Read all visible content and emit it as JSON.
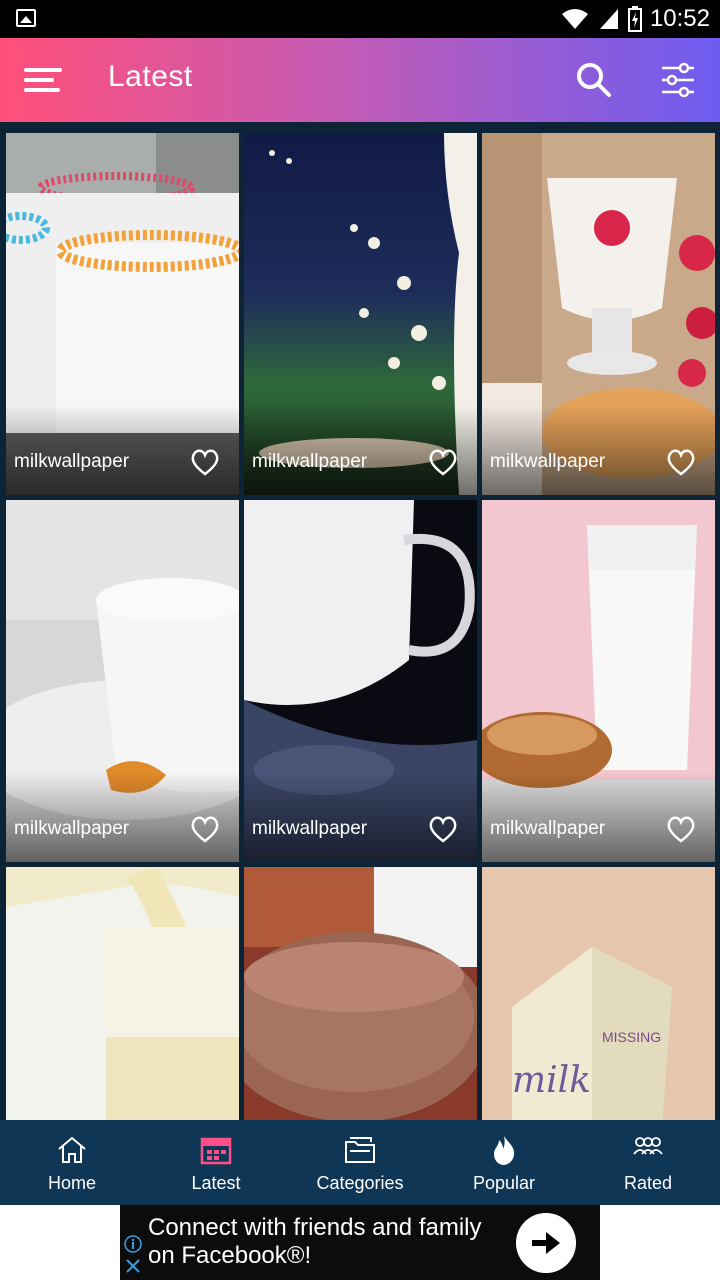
{
  "status_bar": {
    "time": "10:52"
  },
  "app_bar": {
    "title": "Latest"
  },
  "grid": {
    "items": [
      {
        "label": "milkwallpaper"
      },
      {
        "label": "milkwallpaper"
      },
      {
        "label": "milkwallpaper"
      },
      {
        "label": "milkwallpaper"
      },
      {
        "label": "milkwallpaper"
      },
      {
        "label": "milkwallpaper"
      },
      {
        "label": ""
      },
      {
        "label": ""
      },
      {
        "label": ""
      }
    ],
    "carton_text": {
      "missing": "MISSING",
      "milk": "milk"
    }
  },
  "bottom_nav": {
    "items": [
      {
        "label": "Home",
        "icon": "home-icon"
      },
      {
        "label": "Latest",
        "icon": "calendar-icon",
        "active": true
      },
      {
        "label": "Categories",
        "icon": "folder-icon"
      },
      {
        "label": "Popular",
        "icon": "fire-icon"
      },
      {
        "label": "Rated",
        "icon": "group-icon"
      }
    ],
    "active_color": "#ff4f8a"
  },
  "ad": {
    "text": "Connect with friends and family on Facebook®!"
  },
  "colors": {
    "gradient_start": "#ff4f7a",
    "gradient_end": "#6d5cf0",
    "nav_bg": "#0f3654",
    "grid_bg": "#0d2436"
  }
}
